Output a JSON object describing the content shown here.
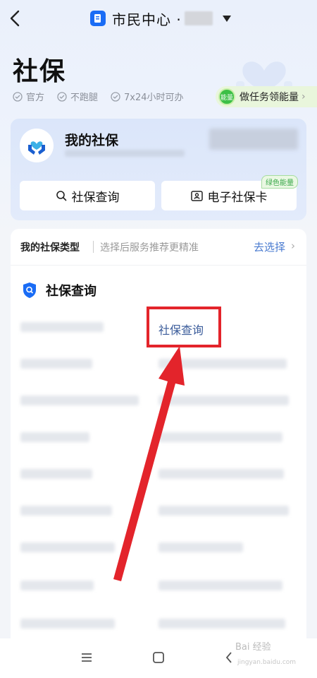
{
  "nav": {
    "title": "市民中心 ·",
    "icons": {
      "back": "back-arrow-icon",
      "app": "citizen-center-app-icon",
      "dropdown": "dropdown-triangle-icon"
    }
  },
  "page": {
    "title": "社保",
    "tags": [
      "官方",
      "不跑腿",
      "7x24小时可办"
    ],
    "energy": {
      "badge": "能量",
      "label": "做任务领能量",
      "chevron": "›"
    }
  },
  "my_card": {
    "title": "我的社保",
    "query_button": "社保查询",
    "ecard_button": "电子社保卡",
    "ecard_tag": "绿色能量"
  },
  "type_row": {
    "label": "我的社保类型",
    "hint": "选择后服务推荐更精准",
    "action": "去选择",
    "chevron": "›"
  },
  "section": {
    "title": "社保查询",
    "highlighted_item": "社保查询"
  },
  "watermark": {
    "brand": "Bai 经验",
    "url": "jingyan.baidu.com"
  },
  "colors": {
    "accent": "#1a6cf5",
    "highlight": "#e3242b",
    "link": "#4a7bd0",
    "energy_green": "#3cbf46"
  }
}
